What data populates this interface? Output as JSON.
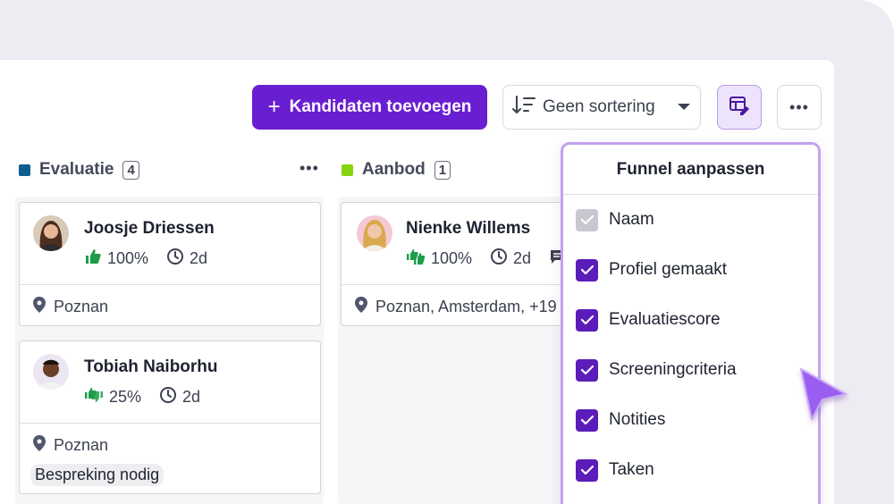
{
  "toolbar": {
    "add_label": "Kandidaten toevoegen",
    "add_icon": "plus-icon",
    "sort_label": "Geen sortering",
    "sort_icon": "sort-icon",
    "funnel_icon": "table-edit-icon",
    "more_icon": "more-horizontal-icon"
  },
  "columns": [
    {
      "name": "Evaluatie",
      "count": "4",
      "color": "#0d5e8c",
      "cards": [
        {
          "name": "Joosje Driessen",
          "score": "100%",
          "time": "2d",
          "location": "Poznan"
        },
        {
          "name": "Tobiah Naiborhu",
          "score": "25%",
          "time": "2d",
          "location": "Poznan",
          "tag": "Bespreking nodig"
        }
      ]
    },
    {
      "name": "Aanbod",
      "count": "1",
      "color": "#84d40f",
      "cards": [
        {
          "name": "Nienke Willems",
          "score": "100%",
          "time": "2d",
          "location": "Poznan, Amsterdam, +19"
        }
      ]
    }
  ],
  "funnel": {
    "title": "Funnel aanpassen",
    "options": [
      {
        "label": "Naam",
        "checked": true,
        "disabled": true
      },
      {
        "label": "Profiel gemaakt",
        "checked": true
      },
      {
        "label": "Evaluatiescore",
        "checked": true
      },
      {
        "label": "Screeningcriteria",
        "checked": true
      },
      {
        "label": "Notities",
        "checked": true
      },
      {
        "label": "Taken",
        "checked": true
      }
    ]
  },
  "colors": {
    "primary": "#6a1ed1",
    "checkbox": "#5b1cb9",
    "score_green": "#1e9c4a",
    "cursor": "#9a5ef0"
  }
}
